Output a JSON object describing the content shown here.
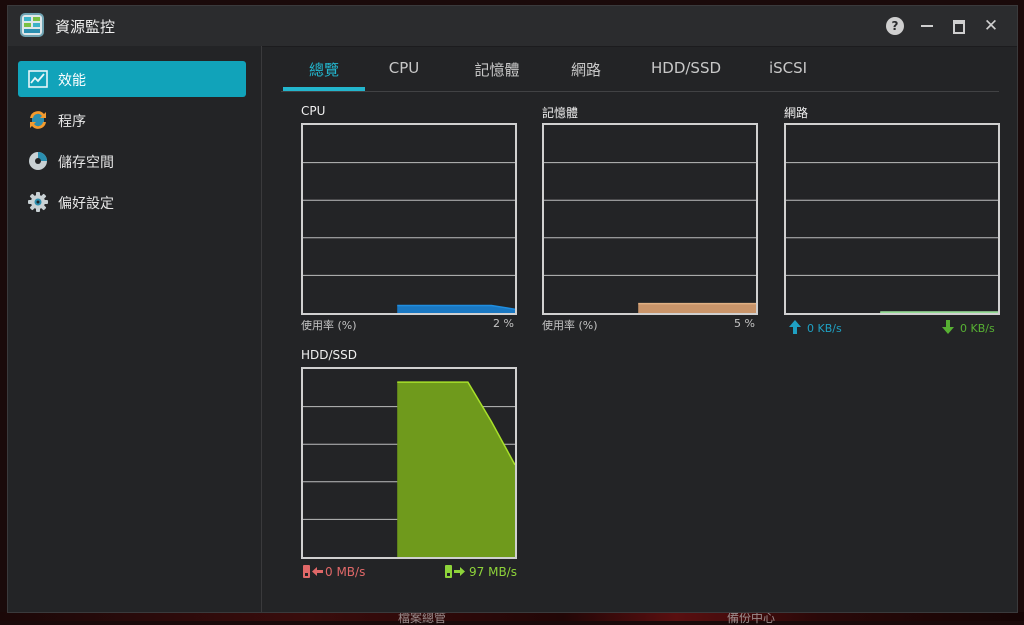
{
  "window": {
    "title": "資源監控"
  },
  "controls": {
    "help": "?",
    "close": "✕"
  },
  "sidebar": {
    "items": [
      {
        "label": "效能",
        "icon": "performance-chart-icon",
        "active": true
      },
      {
        "label": "程序",
        "icon": "process-arrows-icon",
        "active": false
      },
      {
        "label": "儲存空間",
        "icon": "storage-disk-icon",
        "active": false
      },
      {
        "label": "偏好設定",
        "icon": "gear-icon",
        "active": false
      }
    ]
  },
  "tabs": [
    {
      "label": "總覽",
      "active": true
    },
    {
      "label": "CPU",
      "active": false
    },
    {
      "label": "記憶體",
      "active": false
    },
    {
      "label": "網路",
      "active": false
    },
    {
      "label": "HDD/SSD",
      "active": false
    },
    {
      "label": "iSCSI",
      "active": false
    }
  ],
  "panels": {
    "cpu": {
      "title": "CPU",
      "left_label": "使用率 (%)",
      "right_label": "2 %"
    },
    "memory": {
      "title": "記憶體",
      "left_label": "使用率 (%)",
      "right_label": "5 %"
    },
    "network": {
      "title": "網路",
      "upload": "0 KB/s",
      "download": "0 KB/s"
    },
    "disk": {
      "title": "HDD/SSD",
      "read": "0 MB/s",
      "write": "97 MB/s"
    }
  },
  "background": {
    "left_text": "檔案總管",
    "right_text": "備份中心"
  },
  "colors": {
    "accent": "#11a3ba",
    "cpu_fill": "#1a78c2",
    "memory_fill": "#c9956a",
    "network_fill": "#7fd07f",
    "disk_fill": "#6f9a1c",
    "disk_line": "#a8e02a"
  },
  "chart_data": [
    {
      "type": "area",
      "title": "CPU",
      "ylim": [
        0,
        100
      ],
      "series": [
        {
          "name": "使用率 (%)",
          "values": [
            0,
            0,
            0,
            0,
            4,
            4,
            4,
            4,
            4,
            2
          ]
        }
      ]
    },
    {
      "type": "area",
      "title": "記憶體",
      "ylim": [
        0,
        100
      ],
      "series": [
        {
          "name": "使用率 (%)",
          "values": [
            0,
            0,
            0,
            0,
            5,
            5,
            5,
            5,
            5,
            5
          ]
        }
      ]
    },
    {
      "type": "area",
      "title": "網路",
      "ylim": [
        0,
        100
      ],
      "series": [
        {
          "values": [
            0,
            0,
            0,
            0,
            0.5,
            0.5,
            0.5,
            0.5,
            0.5,
            0.5
          ]
        }
      ]
    },
    {
      "type": "area",
      "title": "HDD/SSD",
      "ylim": [
        0,
        100
      ],
      "series": [
        {
          "values": [
            0,
            0,
            0,
            0,
            93,
            93,
            93,
            93,
            72,
            49
          ]
        }
      ]
    }
  ]
}
